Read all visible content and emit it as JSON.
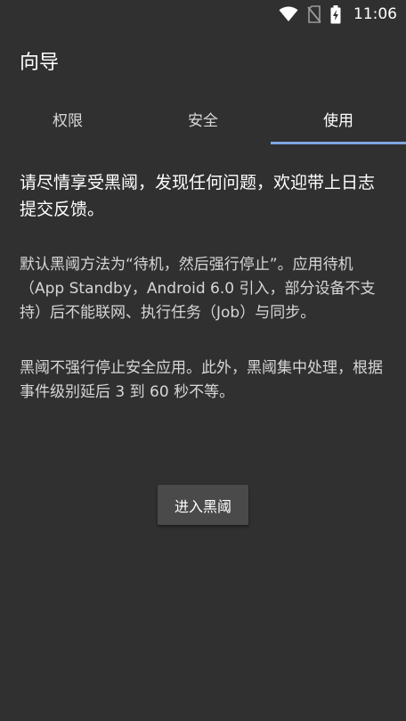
{
  "status_bar": {
    "time": "11:06",
    "icons": [
      "wifi-icon",
      "no-sim-icon",
      "battery-icon"
    ]
  },
  "app_bar": {
    "title": "向导"
  },
  "tabs": [
    {
      "label": "权限",
      "active": false
    },
    {
      "label": "安全",
      "active": false
    },
    {
      "label": "使用",
      "active": true
    }
  ],
  "content": {
    "headline": "请尽情享受黑阈，发现任何问题，欢迎带上日志提交反馈。",
    "paragraph1": "默认黑阈方法为“待机，然后强行停止”。应用待机（App Standby，Android 6.0 引入，部分设备不支持）后不能联网、执行任务（Job）与同步。",
    "paragraph2": "黑阈不强行停止安全应用。此外，黑阈集中处理，根据事件级别延后 3 到 60 秒不等。"
  },
  "actions": {
    "enter_label": "进入黑阈"
  },
  "colors": {
    "background": "#303030",
    "tab_indicator": "#7ea6e0",
    "button": "#4a4a4a"
  }
}
